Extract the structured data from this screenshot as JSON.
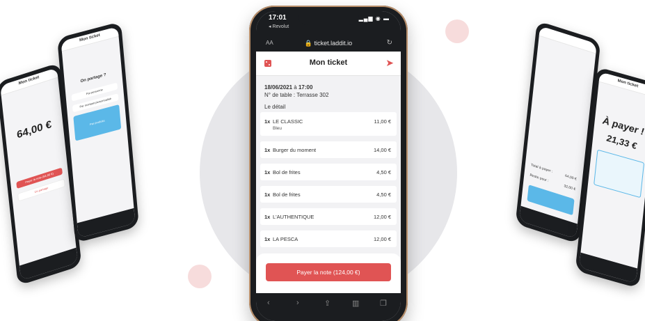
{
  "status": {
    "time": "17:01",
    "back_app": "◂ Revolut"
  },
  "browser": {
    "aa": "AA",
    "url": "ticket.laddit.io",
    "reload_icon": "reload-icon"
  },
  "header": {
    "title": "Mon ticket",
    "left_icon": "dice-icon",
    "right_icon": "send-icon"
  },
  "info": {
    "date": "18/06/2021",
    "at": "à",
    "hour": "17:00",
    "table": "N° de table : Terrasse 302"
  },
  "detail_label": "Le détail",
  "items": [
    {
      "qty": "1x",
      "name": "LE CLASSIC",
      "sub": "Bleu",
      "price": "11,00 €"
    },
    {
      "qty": "1x",
      "name": "Burger du moment",
      "sub": "",
      "price": "14,00 €"
    },
    {
      "qty": "1x",
      "name": "Bol de frites",
      "sub": "",
      "price": "4,50 €"
    },
    {
      "qty": "1x",
      "name": "Bol de frites",
      "sub": "",
      "price": "4,50 €"
    },
    {
      "qty": "1x",
      "name": "L'AUTHENTIQUE",
      "sub": "",
      "price": "12,00 €"
    },
    {
      "qty": "1x",
      "name": "LA PESCA",
      "sub": "",
      "price": "12,00 €"
    }
  ],
  "pay_button": "Payer la note (124,00 €)",
  "side_left1": {
    "title": "Mon ticket",
    "amount": "64,00 €",
    "btn1": "Payer la note (64,00 €)",
    "btn2": "Un partage"
  },
  "side_left2": {
    "title": "Mon ticket",
    "question": "On partage ?",
    "opt1": "Par personne",
    "opt2": "Par montant personnalisé",
    "opt3": "Par produits"
  },
  "side_right1": {
    "total_label": "Total à payer :",
    "total": "64,00 €",
    "reste": "Reste pour :",
    "reste_val": "32,00 €"
  },
  "side_right2": {
    "title": "Mon ticket",
    "heading": "À payer !",
    "amount": "21,33 €"
  },
  "colors": {
    "accent": "#e05454",
    "blue": "#5bb8e8",
    "bg_circle": "#e7e7ea",
    "dot": "#f7dcdc"
  }
}
